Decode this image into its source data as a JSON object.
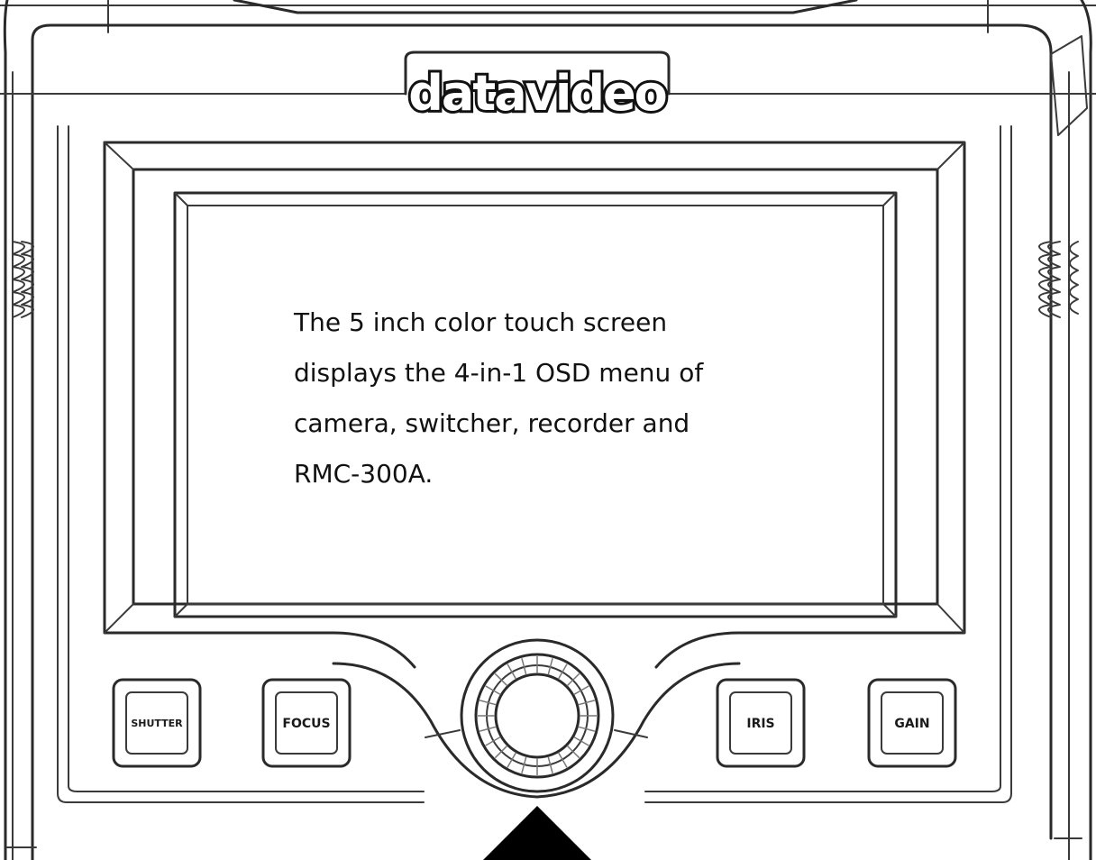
{
  "brand": {
    "logo_text": "datavideo"
  },
  "screen": {
    "caption_lines": [
      "The 5 inch color touch screen",
      "displays the 4-in-1 OSD menu of",
      "camera, switcher, recorder and",
      "RMC-300A."
    ]
  },
  "buttons": {
    "shutter": "SHUTTER",
    "focus": "FOCUS",
    "iris": "IRIS",
    "gain": "GAIN"
  },
  "colors": {
    "line": "#2a2a2a",
    "pointer": "#000000",
    "background": "#ffffff"
  }
}
